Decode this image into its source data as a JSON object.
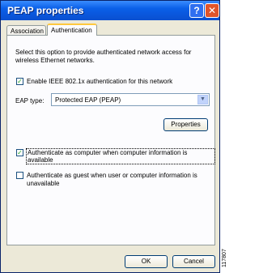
{
  "window": {
    "title": "PEAP properties",
    "help_glyph": "?",
    "close_glyph": "✕"
  },
  "tabs": [
    {
      "label": "Association"
    },
    {
      "label": "Authentication"
    }
  ],
  "auth": {
    "description": "Select this option to provide authenticated network access for wireless Ethernet networks.",
    "enable_8021x": {
      "label": "Enable IEEE 802.1x authentication for this network",
      "checked": true
    },
    "eap_type": {
      "label": "EAP type:",
      "value": "Protected EAP (PEAP)"
    },
    "properties_label": "Properties",
    "auth_as_computer": {
      "label": "Authenticate as computer when computer information is available",
      "checked": true
    },
    "auth_as_guest": {
      "label": "Authenticate as guest when user or computer information is unavailable",
      "checked": false
    }
  },
  "footer": {
    "ok_label": "OK",
    "cancel_label": "Cancel"
  },
  "side_id": "117807",
  "icons": {
    "check": "check-icon",
    "dropdown": "chevron-down-icon"
  }
}
